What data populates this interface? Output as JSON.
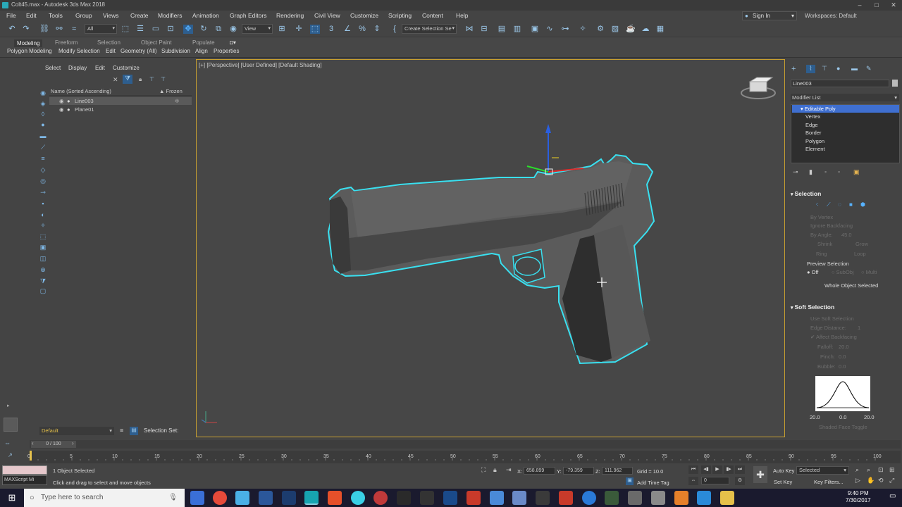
{
  "window": {
    "title": "Colt45.max - Autodesk 3ds Max 2018",
    "controls": [
      "–",
      "□",
      "✕"
    ]
  },
  "menubar": {
    "items": [
      "File",
      "Edit",
      "Tools",
      "Group",
      "Views",
      "Create",
      "Modifiers",
      "Animation",
      "Graph Editors",
      "Rendering",
      "Civil View",
      "Customize",
      "Scripting",
      "Content",
      "Help"
    ],
    "signin": "Sign In",
    "workspaces_label": "Workspaces:",
    "workspaces_value": "Default"
  },
  "toolbar": {
    "filter_value": "All",
    "refcoord_value": "View",
    "selset_value": "Create Selection Se"
  },
  "ribbon": {
    "tabs": [
      "Modeling",
      "Freeform",
      "Selection",
      "Object Paint",
      "Populate"
    ],
    "subitems": [
      "Polygon Modeling",
      "Modify Selection",
      "Edit",
      "Geometry (All)",
      "Subdivision",
      "Align",
      "Properties"
    ]
  },
  "explorer": {
    "tabs": [
      "Select",
      "Display",
      "Edit",
      "Customize"
    ],
    "col_name": "Name (Sorted Ascending)",
    "col_frozen": "▲ Frozen",
    "rows": [
      {
        "name": "Line003",
        "selected": true
      },
      {
        "name": "Plane01",
        "selected": false
      }
    ]
  },
  "viewport": {
    "label": "[+] [Perspective] [User Defined] [Default Shading]"
  },
  "cmdpanel": {
    "object_name": "Line003",
    "modifier_list": "Modifier List",
    "stack": [
      {
        "label": "Editable Poly",
        "selected": true
      },
      {
        "label": "Vertex",
        "selected": false
      },
      {
        "label": "Edge",
        "selected": false
      },
      {
        "label": "Border",
        "selected": false
      },
      {
        "label": "Polygon",
        "selected": false
      },
      {
        "label": "Element",
        "selected": false
      }
    ],
    "selection": {
      "header": "Selection",
      "by_vertex": "By Vertex",
      "ignore_backfacing": "Ignore Backfacing",
      "by_angle": "By Angle:",
      "by_angle_value": "45.0",
      "shrink": "Shrink",
      "grow": "Grow",
      "ring": "Ring",
      "loop": "Loop",
      "preview": "Preview Selection",
      "off": "Off",
      "subobj": "SubObj",
      "multi": "Multi",
      "status": "Whole Object Selected"
    },
    "soft": {
      "header": "Soft Selection",
      "use_soft": "Use Soft Selection",
      "edge_distance": "Edge Distance:",
      "edge_distance_value": "1",
      "affect_backfacing": "Affect Backfacing",
      "falloff": "Falloff:",
      "falloff_value": "20.0",
      "pinch": "Pinch:",
      "pinch_value": "0.0",
      "bubble": "Bubble:",
      "bubble_value": "0.0",
      "curve_labels": [
        "20.0",
        "0.0",
        "20.0"
      ],
      "shaded_face": "Shaded Face Toggle"
    }
  },
  "bottom": {
    "layer": "Default",
    "selection_set": "Selection Set:",
    "time_slider": "0 / 100",
    "ticks": [
      "0",
      "5",
      "10",
      "15",
      "20",
      "25",
      "30",
      "35",
      "40",
      "45",
      "50",
      "55",
      "60",
      "65",
      "70",
      "75",
      "80",
      "85",
      "90",
      "95",
      "100"
    ],
    "maxscript": "MAXScript Mi",
    "status_line1": "1 Object Selected",
    "status_line2": "Click and drag to select and move objects",
    "x_label": "X:",
    "x_value": "658.899",
    "y_label": "Y:",
    "y_value": "-79.359",
    "z_label": "Z:",
    "z_value": "111.962",
    "grid": "Grid = 10.0",
    "add_time_tag": "Add Time Tag",
    "frame": "0",
    "auto_key": "Auto Key",
    "selected": "Selected",
    "set_key": "Set Key",
    "key_filters": "Key Filters..."
  },
  "taskbar": {
    "search": "Type here to search",
    "time": "9:40 PM",
    "date": "7/30/2017"
  },
  "colors": {
    "accent_blue": "#3f6fd0",
    "viewport_border": "#c8a030",
    "selection_outline": "#39e0f0"
  }
}
